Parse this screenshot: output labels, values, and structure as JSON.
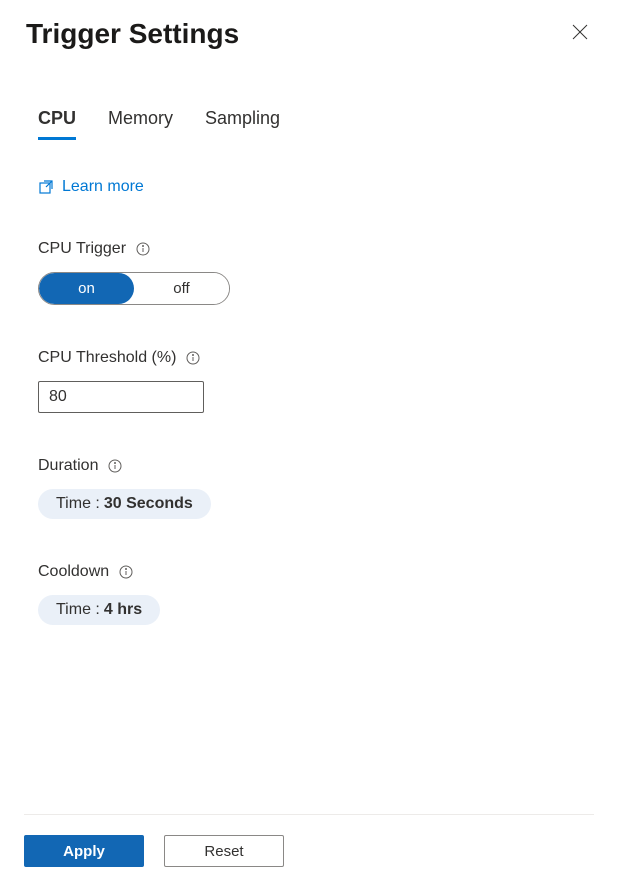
{
  "header": {
    "title": "Trigger Settings"
  },
  "tabs": [
    {
      "label": "CPU",
      "active": true
    },
    {
      "label": "Memory",
      "active": false
    },
    {
      "label": "Sampling",
      "active": false
    }
  ],
  "learn_more": "Learn more",
  "fields": {
    "cpu_trigger": {
      "label": "CPU Trigger",
      "on": "on",
      "off": "off"
    },
    "cpu_threshold": {
      "label": "CPU Threshold (%)",
      "value": "80"
    },
    "duration": {
      "label": "Duration",
      "pill_prefix": "Time : ",
      "pill_value": "30 Seconds"
    },
    "cooldown": {
      "label": "Cooldown",
      "pill_prefix": "Time : ",
      "pill_value": "4 hrs"
    }
  },
  "footer": {
    "apply": "Apply",
    "reset": "Reset"
  }
}
